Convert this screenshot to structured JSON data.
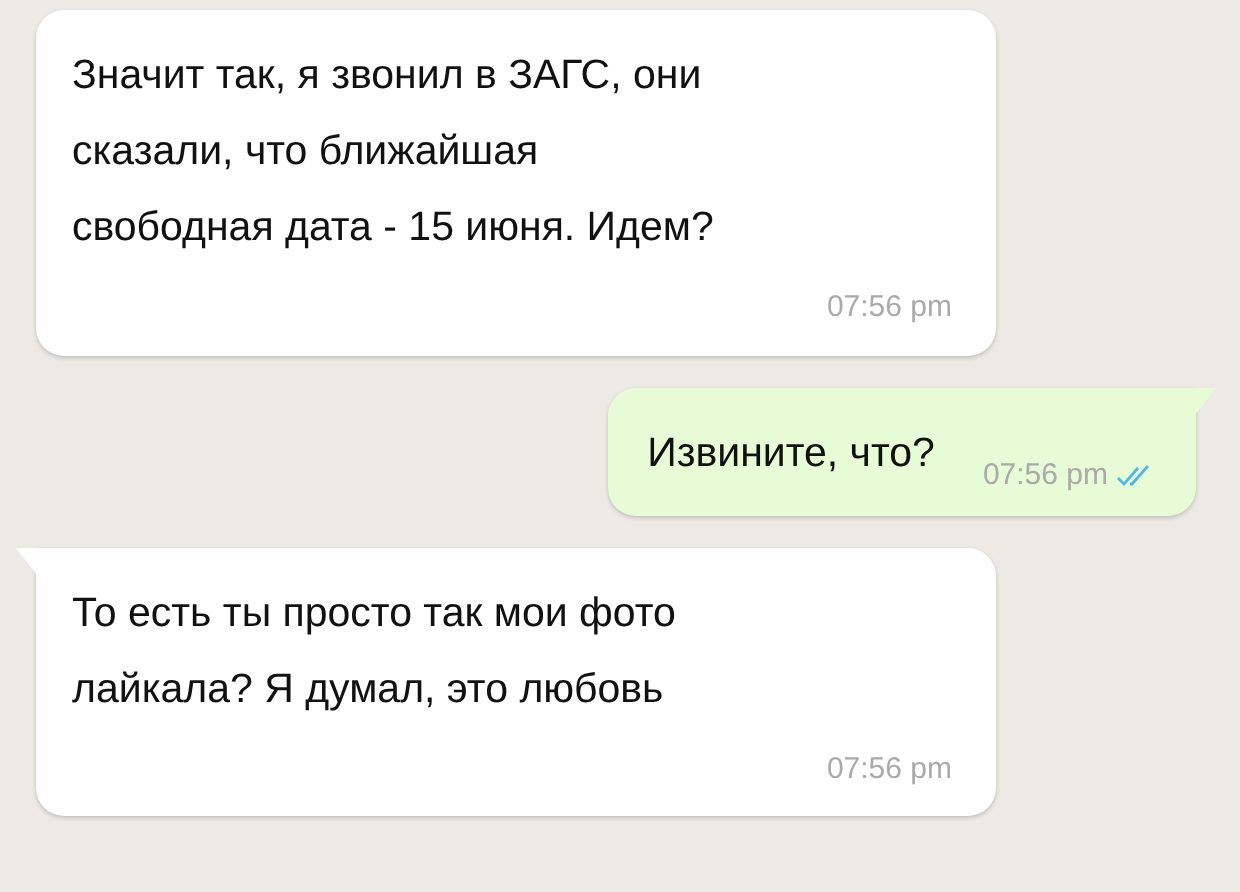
{
  "messages": [
    {
      "kind": "incoming",
      "tail": false,
      "lines": [
        "Значит так, я звонил в ЗАГС, они",
        "сказали, что ближайшая",
        "свободная дата - 15 июня. Идем?"
      ],
      "time": "07:56 pm"
    },
    {
      "kind": "outgoing",
      "tail": true,
      "lines": [
        "Извините, что?"
      ],
      "time": "07:56 pm",
      "read": true
    },
    {
      "kind": "incoming",
      "tail": true,
      "lines": [
        "То есть ты просто так мои фото",
        "лайкала? Я думал, это любовь"
      ],
      "time": "07:56 pm"
    }
  ]
}
